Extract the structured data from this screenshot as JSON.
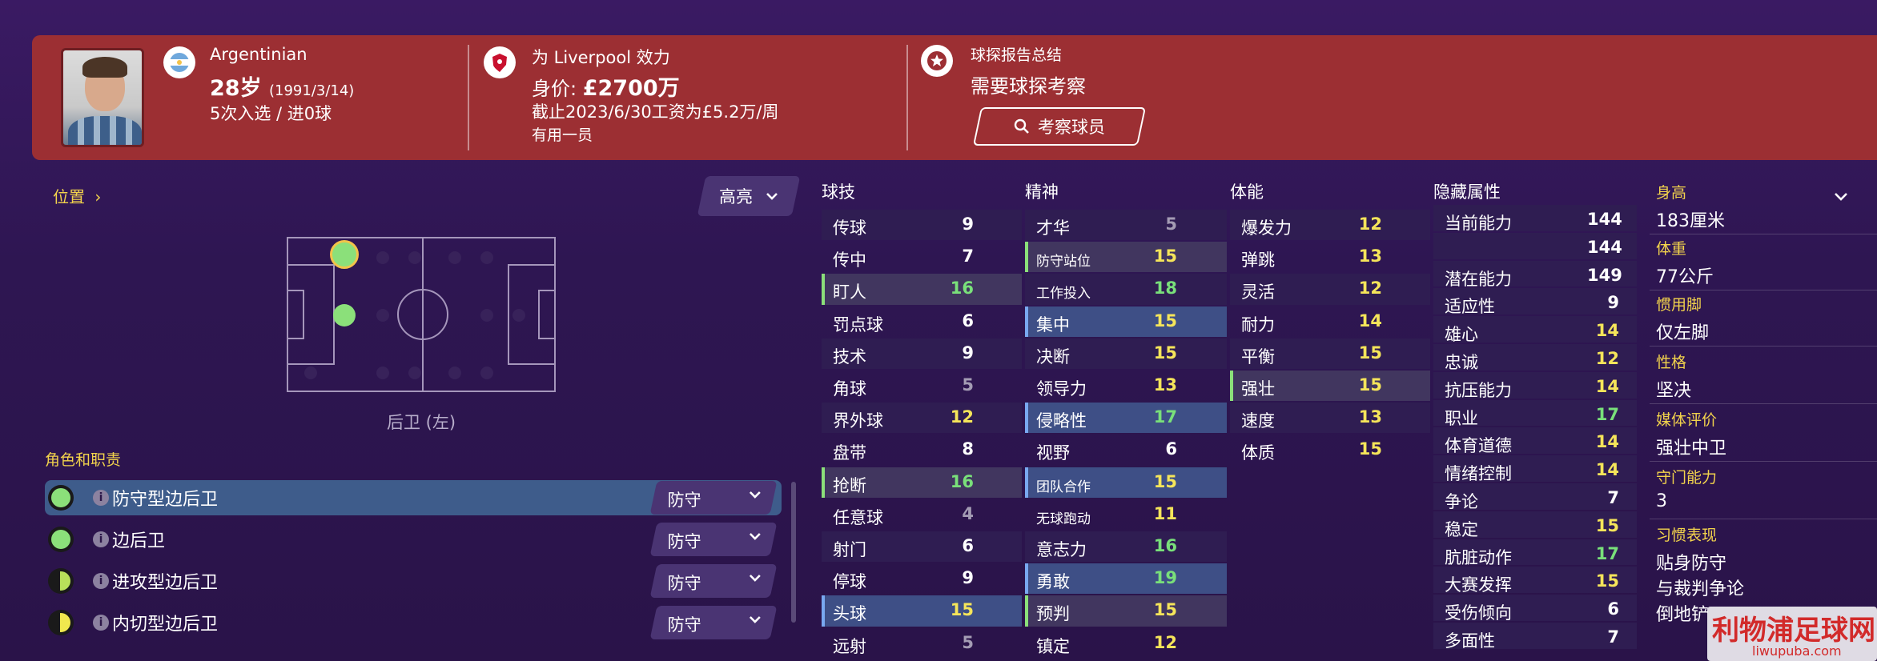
{
  "header": {
    "nationality": "Argentinian",
    "age": "28岁",
    "dob": "(1991/3/14)",
    "caps": "5次入选 / 进0球",
    "club_line": "为 Liverpool 效力",
    "value_label": "身价: ",
    "value": "£2700万",
    "contract": "截止2023/6/30工资为£5.2万/周",
    "squad_status": "有用一员",
    "scout_title": "球探报告总结",
    "scout_status": "需要球探考察",
    "scout_button": "考察球员"
  },
  "position": {
    "link_label": "位置",
    "highlight_label": "高亮",
    "position_name": "后卫 (左)"
  },
  "roles": {
    "title": "角色和职责",
    "items": [
      {
        "label": "防守型边后卫",
        "duty": "防守",
        "color": "#8be07a",
        "shape": "full"
      },
      {
        "label": "边后卫",
        "duty": "防守",
        "color": "#8be07a",
        "shape": "full"
      },
      {
        "label": "进攻型边后卫",
        "duty": "防守",
        "color": "#b8e05a",
        "shape": "half"
      },
      {
        "label": "内切型边后卫",
        "duty": "防守",
        "color": "#f0e84e",
        "shape": "half"
      }
    ]
  },
  "attributes": {
    "technical": {
      "title": "球技",
      "rows": [
        {
          "name": "传球",
          "value": "9",
          "tone": "w"
        },
        {
          "name": "传中",
          "value": "7",
          "tone": "w"
        },
        {
          "name": "盯人",
          "value": "16",
          "tone": "g"
        },
        {
          "name": "罚点球",
          "value": "6",
          "tone": "w"
        },
        {
          "name": "技术",
          "value": "9",
          "tone": "w"
        },
        {
          "name": "角球",
          "value": "5",
          "tone": "gr"
        },
        {
          "name": "界外球",
          "value": "12",
          "tone": "y"
        },
        {
          "name": "盘带",
          "value": "8",
          "tone": "w"
        },
        {
          "name": "抢断",
          "value": "16",
          "tone": "g"
        },
        {
          "name": "任意球",
          "value": "4",
          "tone": "gr"
        },
        {
          "name": "射门",
          "value": "6",
          "tone": "w"
        },
        {
          "name": "停球",
          "value": "9",
          "tone": "w"
        },
        {
          "name": "头球",
          "value": "15",
          "tone": "y"
        },
        {
          "name": "远射",
          "value": "5",
          "tone": "gr"
        }
      ]
    },
    "mental": {
      "title": "精神",
      "rows": [
        {
          "name": "才华",
          "value": "5",
          "tone": "gr"
        },
        {
          "name": "防守站位",
          "value": "15",
          "tone": "y"
        },
        {
          "name": "工作投入",
          "value": "18",
          "tone": "g"
        },
        {
          "name": "集中",
          "value": "15",
          "tone": "y"
        },
        {
          "name": "决断",
          "value": "15",
          "tone": "y"
        },
        {
          "name": "领导力",
          "value": "13",
          "tone": "y"
        },
        {
          "name": "侵略性",
          "value": "17",
          "tone": "g"
        },
        {
          "name": "视野",
          "value": "6",
          "tone": "w"
        },
        {
          "name": "团队合作",
          "value": "15",
          "tone": "y"
        },
        {
          "name": "无球跑动",
          "value": "11",
          "tone": "y"
        },
        {
          "name": "意志力",
          "value": "16",
          "tone": "g"
        },
        {
          "name": "勇敢",
          "value": "19",
          "tone": "g"
        },
        {
          "name": "预判",
          "value": "15",
          "tone": "y"
        },
        {
          "name": "镇定",
          "value": "12",
          "tone": "y"
        }
      ]
    },
    "physical": {
      "title": "体能",
      "rows": [
        {
          "name": "爆发力",
          "value": "12",
          "tone": "y"
        },
        {
          "name": "弹跳",
          "value": "13",
          "tone": "y"
        },
        {
          "name": "灵活",
          "value": "12",
          "tone": "y"
        },
        {
          "name": "耐力",
          "value": "14",
          "tone": "y"
        },
        {
          "name": "平衡",
          "value": "15",
          "tone": "y"
        },
        {
          "name": "强壮",
          "value": "15",
          "tone": "y"
        },
        {
          "name": "速度",
          "value": "13",
          "tone": "y"
        },
        {
          "name": "体质",
          "value": "15",
          "tone": "y"
        }
      ]
    },
    "hidden": {
      "title": "隐藏属性",
      "rows": [
        {
          "name": "当前能力",
          "value": "144",
          "tone": "w"
        },
        {
          "name": "",
          "value": "144",
          "tone": "w"
        },
        {
          "name": "潜在能力",
          "value": "149",
          "tone": "w"
        },
        {
          "name": "适应性",
          "value": "9",
          "tone": "w"
        },
        {
          "name": "雄心",
          "value": "14",
          "tone": "y"
        },
        {
          "name": "忠诚",
          "value": "12",
          "tone": "y"
        },
        {
          "name": "抗压能力",
          "value": "14",
          "tone": "y"
        },
        {
          "name": "职业",
          "value": "17",
          "tone": "g"
        },
        {
          "name": "体育道德",
          "value": "14",
          "tone": "y"
        },
        {
          "name": "情绪控制",
          "value": "14",
          "tone": "y"
        },
        {
          "name": "争论",
          "value": "7",
          "tone": "w"
        },
        {
          "name": "稳定",
          "value": "15",
          "tone": "y"
        },
        {
          "name": "肮脏动作",
          "value": "17",
          "tone": "g"
        },
        {
          "name": "大赛发挥",
          "value": "15",
          "tone": "y"
        },
        {
          "name": "受伤倾向",
          "value": "6",
          "tone": "w"
        },
        {
          "name": "多面性",
          "value": "7",
          "tone": "w"
        }
      ]
    }
  },
  "info": {
    "height_label": "身高",
    "height": "183厘米",
    "weight_label": "体重",
    "weight": "77公斤",
    "foot_label": "惯用脚",
    "foot": "仅左脚",
    "personality_label": "性格",
    "personality": "坚决",
    "media_label": "媒体评价",
    "media": "强壮中卫",
    "gk_label": "守门能力",
    "gk": "3",
    "habits_label": "习惯表现",
    "habits": [
      "贴身防守",
      "与裁判争论",
      "倒地铲"
    ]
  },
  "watermark": {
    "title": "利物浦足球网",
    "url": "liwupuba.com"
  },
  "colors": {
    "header": "#9c2f33",
    "accent": "#f2d34c",
    "good": "#79e07a",
    "ok": "#f5e55a"
  }
}
